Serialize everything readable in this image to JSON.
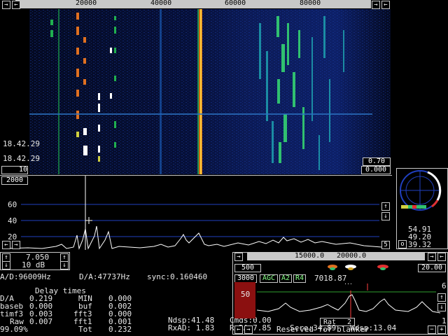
{
  "waterfall": {
    "scale_labels": [
      "20000",
      "40000",
      "60000",
      "80000"
    ],
    "timestamps": [
      "18.42.29",
      "18.42.29"
    ],
    "gain_top": "0.70",
    "gain_bottom": "0.000",
    "avg_count": "10"
  },
  "spectrum": {
    "scale_top": "2000",
    "y_labels": [
      "60",
      "40",
      "20"
    ],
    "right_value": "5"
  },
  "polar": {
    "values": [
      "54.91",
      "49.20",
      "39.32"
    ],
    "indicator": "o"
  },
  "controls": {
    "level_value": "7.050",
    "db_value": "10 dB"
  },
  "info": {
    "ad_rate": "A/D:96009Hz",
    "da_rate": "D/A:47737Hz",
    "sync": "sync:0.160460",
    "delay_title": "Delay times",
    "rows": [
      {
        "c1": "D/A",
        "v1": "0.219",
        "c2": "MIN",
        "v2": "0.000"
      },
      {
        "c1": "baseb",
        "v1": "0.000",
        "c2": "buf",
        "v2": "0.002"
      },
      {
        "c1": "timf3",
        "v1": "0.003",
        "c2": "fft3",
        "v2": "0.000"
      },
      {
        "c1": "Raw",
        "v1": "0.007",
        "c2": "fft1",
        "v2": "0.001"
      },
      {
        "c1": "99.09%",
        "v1": "",
        "c2": "Tot",
        "v2": "0.232"
      }
    ],
    "ndsp": "Ndsp:41.48",
    "cmds": "Cmds:0.00",
    "rxad": "RxAD: 1.83",
    "rxda": "RxDA:7.85",
    "scre": "Scre:34.89",
    "wdsp": "Wdsp:13.04"
  },
  "baseband": {
    "scale_labels": [
      "15000.0",
      "20000.0"
    ],
    "bw_left": "500",
    "gain_right": "20.00",
    "bw_value": "3000",
    "agc": "AGC",
    "a2": "A2",
    "r4": "R4",
    "freq": "7018.87",
    "level": "50",
    "right_top": "6",
    "right_bottom": "1",
    "rat_label": "Rat",
    "rat_value": "2",
    "blanker_text": "Reserved for blanker"
  },
  "colors": {
    "accent_green": "#88ff88",
    "grid_blue": "#2040c0",
    "bar_red": "#8b1010"
  }
}
